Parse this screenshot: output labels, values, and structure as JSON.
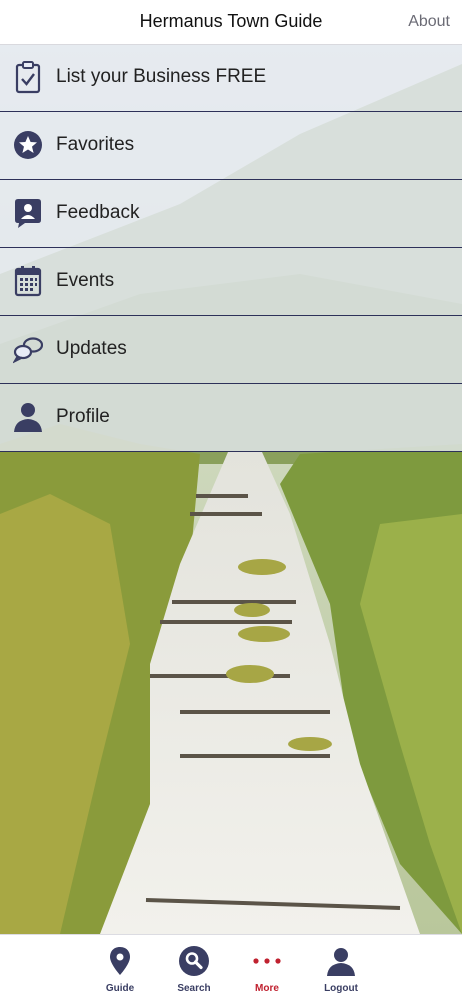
{
  "header": {
    "title": "Hermanus Town Guide",
    "about_label": "About"
  },
  "menu": {
    "items": [
      {
        "label": "List your Business FREE",
        "icon": "clipboard-check-icon"
      },
      {
        "label": "Favorites",
        "icon": "star-icon"
      },
      {
        "label": "Feedback",
        "icon": "feedback-icon"
      },
      {
        "label": "Events",
        "icon": "calendar-icon"
      },
      {
        "label": "Updates",
        "icon": "chat-bubbles-icon"
      },
      {
        "label": "Profile",
        "icon": "person-icon"
      }
    ]
  },
  "tabbar": {
    "tabs": [
      {
        "label": "Guide",
        "icon": "map-pin-icon"
      },
      {
        "label": "Search",
        "icon": "search-icon"
      },
      {
        "label": "More",
        "icon": "more-dots-icon",
        "active": true
      },
      {
        "label": "Logout",
        "icon": "person-icon"
      }
    ]
  },
  "colors": {
    "navy": "#3a3e63",
    "accent_red": "#c0212f",
    "menu_divider": "#2d3159"
  }
}
